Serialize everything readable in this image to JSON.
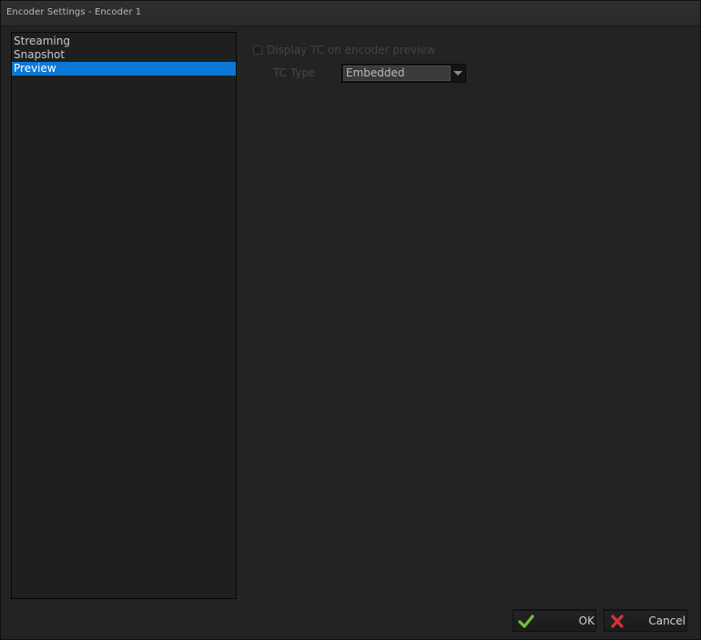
{
  "window": {
    "title": "Encoder Settings - Encoder 1"
  },
  "sidebar": {
    "items": [
      {
        "label": "Streaming",
        "selected": false
      },
      {
        "label": "Snapshot",
        "selected": false
      },
      {
        "label": "Preview",
        "selected": true
      }
    ]
  },
  "preview": {
    "display_tc_label": "Display TC on encoder preview",
    "display_tc_checked": false,
    "tc_type_label": "TC Type",
    "tc_type_value": "Embedded"
  },
  "buttons": {
    "ok_label": "OK",
    "cancel_label": "Cancel"
  },
  "colors": {
    "selection": "#0a78d7",
    "ok_icon": "#6fc23a",
    "cancel_icon": "#d9303a"
  },
  "icons": {
    "ok": "checkmark-icon",
    "cancel": "x-icon",
    "dropdown": "chevron-down-icon"
  }
}
